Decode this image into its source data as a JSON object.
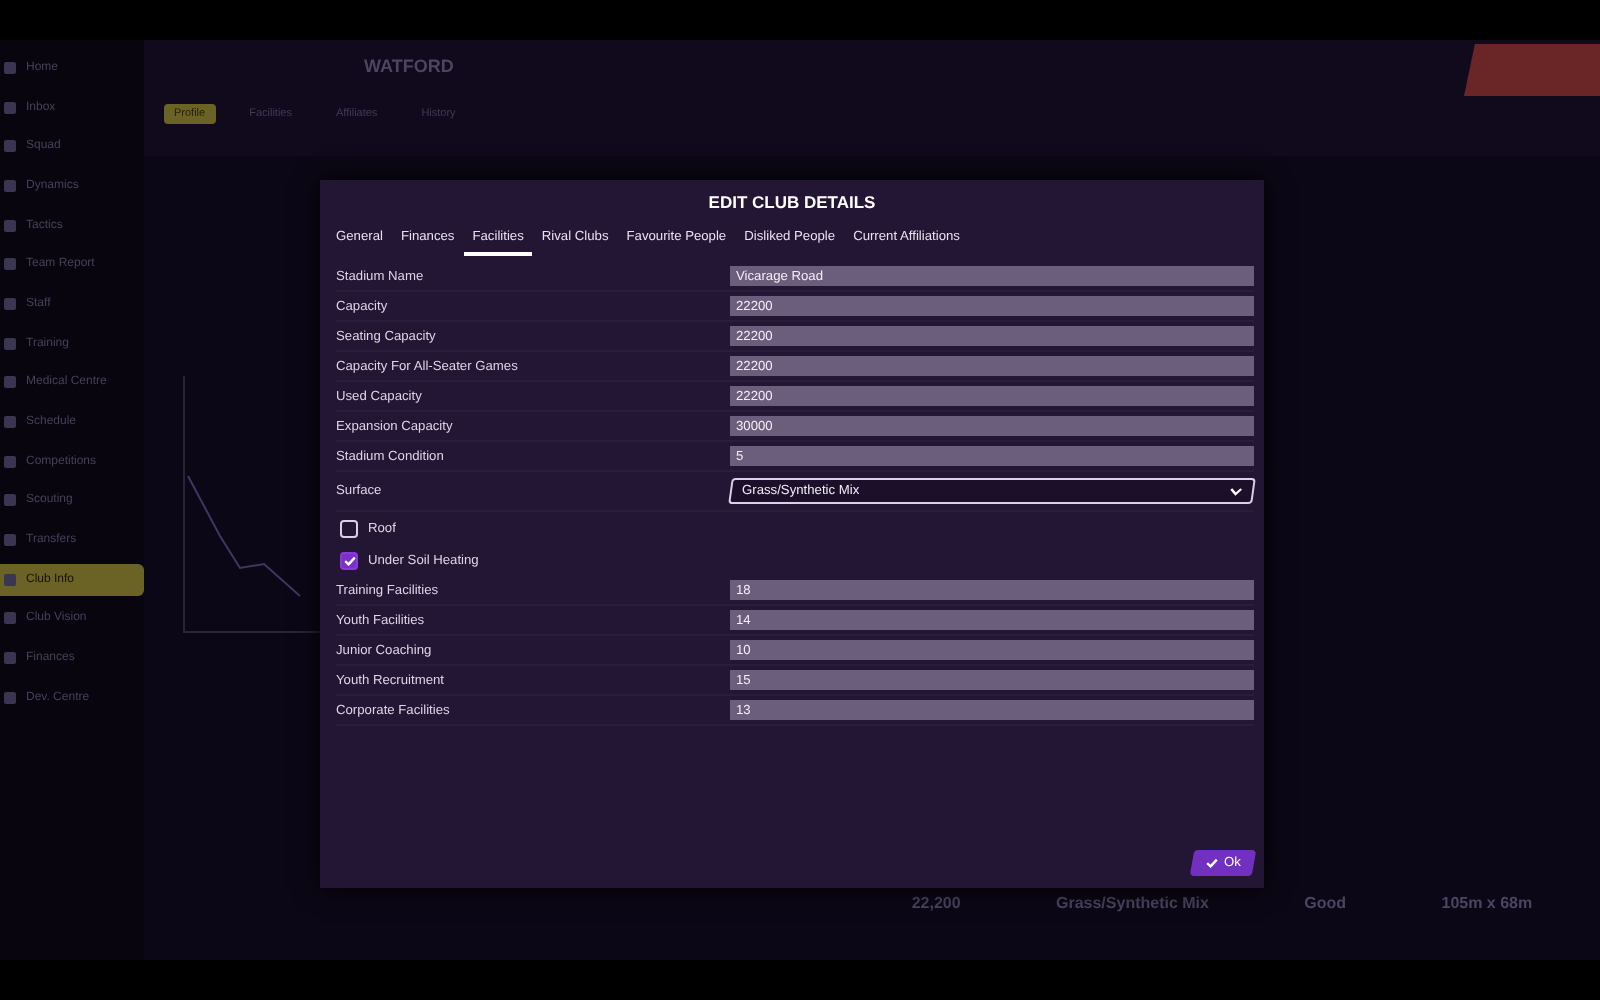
{
  "sidebar": {
    "items": [
      {
        "label": "Home",
        "selected": false
      },
      {
        "label": "Inbox",
        "selected": false
      },
      {
        "label": "Squad",
        "selected": false
      },
      {
        "label": "Dynamics",
        "selected": false
      },
      {
        "label": "Tactics",
        "selected": false
      },
      {
        "label": "Team Report",
        "selected": false
      },
      {
        "label": "Staff",
        "selected": false
      },
      {
        "label": "Training",
        "selected": false
      },
      {
        "label": "Medical Centre",
        "selected": false
      },
      {
        "label": "Schedule",
        "selected": false
      },
      {
        "label": "Competitions",
        "selected": false
      },
      {
        "label": "Scouting",
        "selected": false
      },
      {
        "label": "Transfers",
        "selected": false
      },
      {
        "label": "Club Info",
        "selected": true
      },
      {
        "label": "Club Vision",
        "selected": false
      },
      {
        "label": "Finances",
        "selected": false
      },
      {
        "label": "Dev. Centre",
        "selected": false
      }
    ]
  },
  "header": {
    "title": "WATFORD",
    "tabs": [
      {
        "label": "Profile",
        "selected": true
      },
      {
        "label": "Facilities",
        "selected": false
      },
      {
        "label": "Affiliates",
        "selected": false
      },
      {
        "label": "History",
        "selected": false
      }
    ]
  },
  "stadium_stats": [
    {
      "value": "22,200"
    },
    {
      "value": "Grass/Synthetic Mix"
    },
    {
      "value": "Good"
    },
    {
      "value": "105m x 68m"
    }
  ],
  "dialog": {
    "title": "EDIT CLUB DETAILS",
    "tabs": [
      {
        "label": "General",
        "selected": false
      },
      {
        "label": "Finances",
        "selected": false
      },
      {
        "label": "Facilities",
        "selected": true
      },
      {
        "label": "Rival Clubs",
        "selected": false
      },
      {
        "label": "Favourite People",
        "selected": false
      },
      {
        "label": "Disliked People",
        "selected": false
      },
      {
        "label": "Current Affiliations",
        "selected": false
      }
    ],
    "fields": [
      {
        "kind": "text",
        "label": "Stadium Name",
        "value": "Vicarage Road"
      },
      {
        "kind": "text",
        "label": "Capacity",
        "value": "22200"
      },
      {
        "kind": "text",
        "label": "Seating Capacity",
        "value": "22200"
      },
      {
        "kind": "text",
        "label": "Capacity For All-Seater Games",
        "value": "22200"
      },
      {
        "kind": "text",
        "label": "Used Capacity",
        "value": "22200"
      },
      {
        "kind": "text",
        "label": "Expansion Capacity",
        "value": "30000"
      },
      {
        "kind": "text",
        "label": "Stadium Condition",
        "value": "5"
      },
      {
        "kind": "dropdown",
        "label": "Surface",
        "value": "Grass/Synthetic Mix"
      },
      {
        "kind": "checkbox",
        "label": "Roof",
        "checked": false
      },
      {
        "kind": "checkbox",
        "label": "Under Soil Heating",
        "checked": true
      },
      {
        "kind": "text",
        "label": "Training Facilities",
        "value": "18"
      },
      {
        "kind": "text",
        "label": "Youth Facilities",
        "value": "14"
      },
      {
        "kind": "text",
        "label": "Junior Coaching",
        "value": "10"
      },
      {
        "kind": "text",
        "label": "Youth Recruitment",
        "value": "15"
      },
      {
        "kind": "text",
        "label": "Corporate Facilities",
        "value": "13"
      }
    ],
    "ok_button": "Ok"
  }
}
